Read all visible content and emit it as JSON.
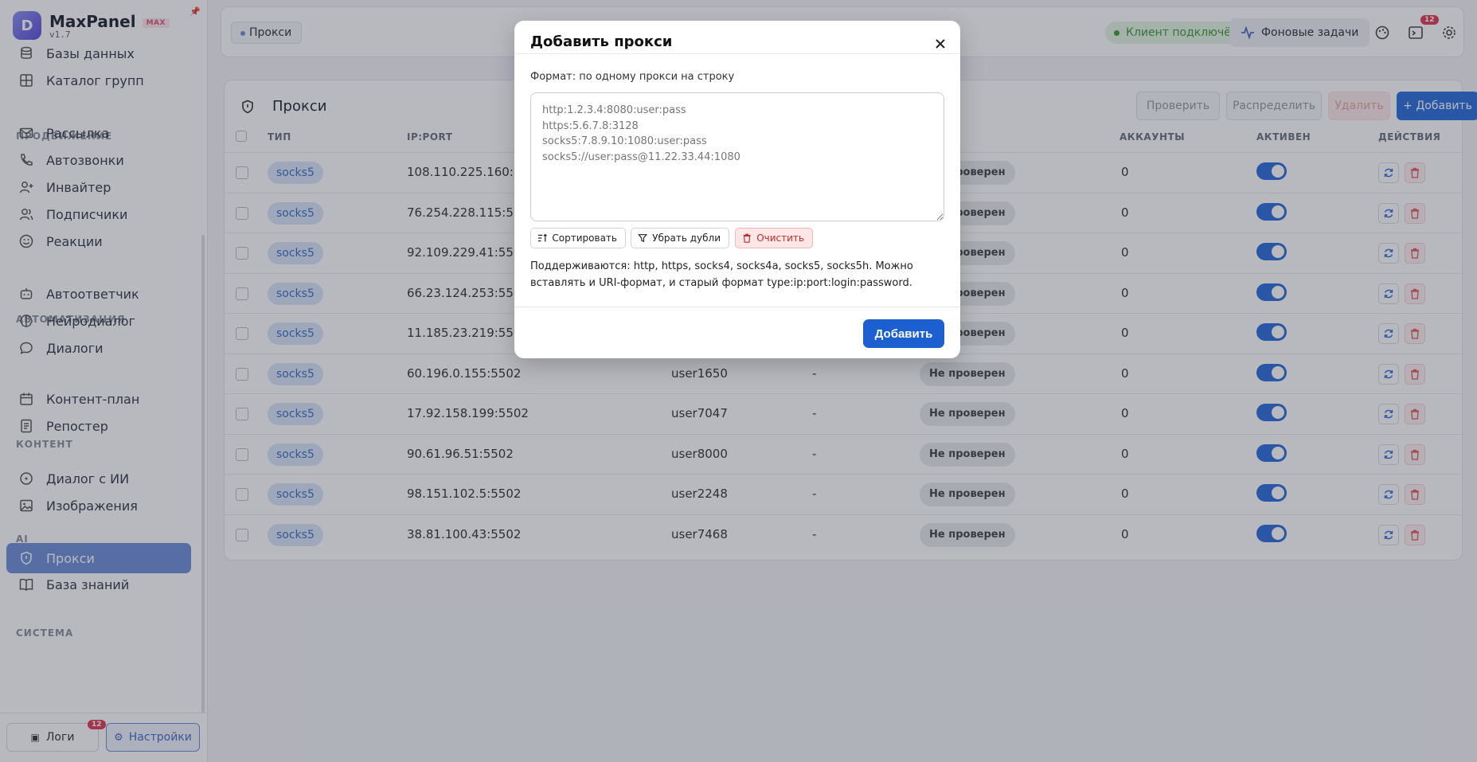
{
  "brand": {
    "name": "MaxPanel",
    "badge": "MAX",
    "version": "v1.7",
    "logo_letter": "D"
  },
  "sidebar": {
    "items": [
      {
        "label": "Базы данных",
        "icon": "database-icon",
        "name": "sidebar-item-databases"
      },
      {
        "label": "Каталог групп",
        "icon": "grid-icon",
        "name": "sidebar-item-group-catalog"
      },
      {
        "label": "Рассылка",
        "icon": "mail-icon",
        "name": "sidebar-item-mailing"
      },
      {
        "label": "Автозвонки",
        "icon": "phone-icon",
        "name": "sidebar-item-autocalls"
      },
      {
        "label": "Инвайтер",
        "icon": "user-plus-icon",
        "name": "sidebar-item-inviter"
      },
      {
        "label": "Подписчики",
        "icon": "users-icon",
        "name": "sidebar-item-subscribers"
      },
      {
        "label": "Реакции",
        "icon": "smile-icon",
        "name": "sidebar-item-reactions"
      },
      {
        "label": "Автоответчик",
        "icon": "bot-icon",
        "name": "sidebar-item-autoresponder"
      },
      {
        "label": "Нейродиалог",
        "icon": "brain-icon",
        "name": "sidebar-item-neurodialog"
      },
      {
        "label": "Диалоги",
        "icon": "chat-icon",
        "name": "sidebar-item-dialogs"
      },
      {
        "label": "Контент-план",
        "icon": "calendar-icon",
        "name": "sidebar-item-content-plan"
      },
      {
        "label": "Репостер",
        "icon": "repost-icon",
        "name": "sidebar-item-reposter"
      },
      {
        "label": "Диалог с ИИ",
        "icon": "ai-chat-icon",
        "name": "sidebar-item-ai-dialog"
      },
      {
        "label": "Изображения",
        "icon": "image-icon",
        "name": "sidebar-item-images"
      },
      {
        "label": "Прокси",
        "icon": "shield-icon",
        "name": "sidebar-item-proxy"
      },
      {
        "label": "База знаний",
        "icon": "book-icon",
        "name": "sidebar-item-knowledge-base"
      }
    ],
    "sections": {
      "promotion": "ПРОДВИЖЕНИЕ",
      "automation": "АВТОМАТИЗАЦИЯ",
      "content": "КОНТЕНТ",
      "ai": "AI",
      "system": "СИСТЕМА"
    },
    "logs_label": "Логи",
    "logs_badge": "12",
    "settings_label": "Настройки"
  },
  "topbar": {
    "breadcrumb": "Прокси",
    "status": "Клиент подключён",
    "bg_tasks": "Фоновые задачи",
    "notif_badge": "12"
  },
  "proxies": {
    "title": "Прокси",
    "actions": {
      "check": "Проверить",
      "distribute": "Распределить",
      "delete": "Удалить",
      "add": "+ Добавить"
    },
    "columns": {
      "type": "ТИП",
      "ipport": "IP:PORT",
      "accounts": "АККАУНТЫ",
      "active": "АКТИВЕН",
      "actions": "ДЕЙСТВИЯ"
    },
    "rows": [
      {
        "type": "socks5",
        "ip": "108.110.225.160:5502",
        "login": "",
        "country": "",
        "status": "Не проверен",
        "accounts": "0"
      },
      {
        "type": "socks5",
        "ip": "76.254.228.115:5502",
        "login": "",
        "country": "",
        "status": "Не проверен",
        "accounts": "0"
      },
      {
        "type": "socks5",
        "ip": "92.109.229.41:5502",
        "login": "",
        "country": "",
        "status": "Не проверен",
        "accounts": "0"
      },
      {
        "type": "socks5",
        "ip": "66.23.124.253:5502",
        "login": "",
        "country": "",
        "status": "Не проверен",
        "accounts": "0"
      },
      {
        "type": "socks5",
        "ip": "11.185.23.219:5502",
        "login": "",
        "country": "",
        "status": "Не проверен",
        "accounts": "0"
      },
      {
        "type": "socks5",
        "ip": "60.196.0.155:5502",
        "login": "user1650",
        "country": "-",
        "status": "Не проверен",
        "accounts": "0"
      },
      {
        "type": "socks5",
        "ip": "17.92.158.199:5502",
        "login": "user7047",
        "country": "-",
        "status": "Не проверен",
        "accounts": "0"
      },
      {
        "type": "socks5",
        "ip": "90.61.96.51:5502",
        "login": "user8000",
        "country": "-",
        "status": "Не проверен",
        "accounts": "0"
      },
      {
        "type": "socks5",
        "ip": "98.151.102.5:5502",
        "login": "user2248",
        "country": "-",
        "status": "Не проверен",
        "accounts": "0"
      },
      {
        "type": "socks5",
        "ip": "38.81.100.43:5502",
        "login": "user7468",
        "country": "-",
        "status": "Не проверен",
        "accounts": "0"
      }
    ]
  },
  "modal": {
    "title": "Добавить прокси",
    "format_label": "Формат: по одному прокси на строку",
    "placeholder": "http:1.2.3.4:8080:user:pass\nhttps:5.6.7.8:3128\nsocks5:7.8.9.10:1080:user:pass\nsocks5://user:pass@11.22.33.44:1080",
    "sort": "Сортировать",
    "dedupe": "Убрать дубли",
    "clear": "Очистить",
    "note": "Поддерживаются: http, https, socks4, socks4a, socks5, socks5h. Можно вставлять и URI-формат, и старый формат type:ip:port:login:password.",
    "submit": "Добавить"
  }
}
